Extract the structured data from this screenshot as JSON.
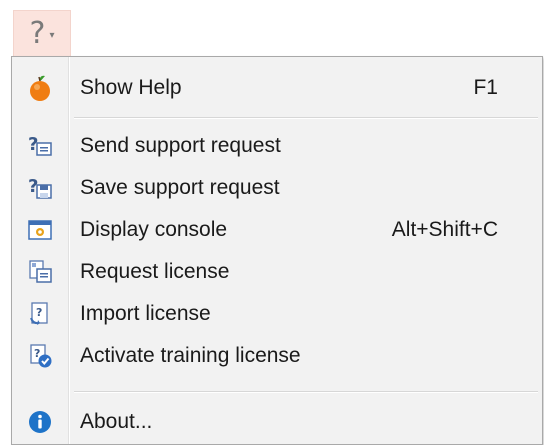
{
  "trigger": {
    "glyph": "?",
    "chevron": "▾"
  },
  "menu": {
    "items": [
      {
        "label": "Show Help",
        "shortcut": "F1",
        "icon": "orange-help-icon"
      },
      {
        "label": "Send support request",
        "shortcut": "",
        "icon": "send-support-request-icon"
      },
      {
        "label": "Save support request",
        "shortcut": "",
        "icon": "save-support-request-icon"
      },
      {
        "label": "Display console",
        "shortcut": "Alt+Shift+C",
        "icon": "console-icon"
      },
      {
        "label": "Request license",
        "shortcut": "",
        "icon": "request-license-icon"
      },
      {
        "label": "Import license",
        "shortcut": "",
        "icon": "import-license-icon"
      },
      {
        "label": "Activate training license",
        "shortcut": "",
        "icon": "activate-license-icon"
      },
      {
        "label": "About...",
        "shortcut": "",
        "icon": "info-icon"
      }
    ]
  },
  "colors": {
    "menu_bg": "#f2f2f2",
    "trigger_bg": "#fbe3dd",
    "info_blue": "#1e73c8",
    "orange": "#f07d12"
  }
}
